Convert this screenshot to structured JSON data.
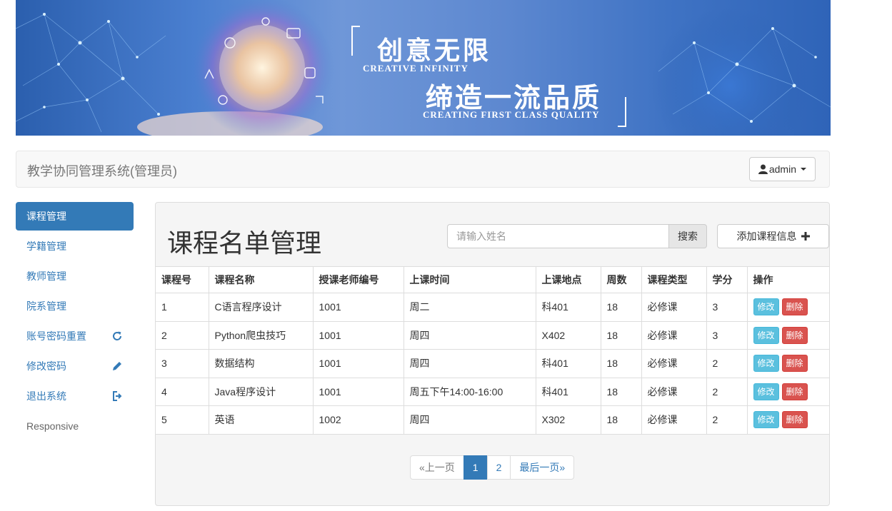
{
  "banner": {
    "title_cn": "创意无限",
    "subtitle_en": "CREATIVE INFINITY",
    "title2_cn": "缔造一流品质",
    "subtitle2_en": "CREATING FIRST CLASS QUALITY"
  },
  "navbar": {
    "brand": "教学协同管理系统(管理员)",
    "user": "admin"
  },
  "sidebar": {
    "items": [
      {
        "label": "课程管理",
        "icon": ""
      },
      {
        "label": "学籍管理",
        "icon": ""
      },
      {
        "label": "教师管理",
        "icon": ""
      },
      {
        "label": "院系管理",
        "icon": ""
      },
      {
        "label": "账号密码重置",
        "icon": "refresh-icon"
      },
      {
        "label": "修改密码",
        "icon": "pencil-icon"
      },
      {
        "label": "退出系统",
        "icon": "logout-icon"
      },
      {
        "label": "Responsive",
        "icon": ""
      }
    ]
  },
  "main": {
    "title": "课程名单管理",
    "search_placeholder": "请输入姓名",
    "search_button": "搜索",
    "add_button": "添加课程信息",
    "columns": [
      "课程号",
      "课程名称",
      "授课老师编号",
      "上课时间",
      "上课地点",
      "周数",
      "课程类型",
      "学分",
      "操作"
    ],
    "rows": [
      [
        "1",
        "C语言程序设计",
        "1001",
        "周二",
        "科401",
        "18",
        "必修课",
        "3"
      ],
      [
        "2",
        "Python爬虫技巧",
        "1001",
        "周四",
        "X402",
        "18",
        "必修课",
        "3"
      ],
      [
        "3",
        "数据结构",
        "1001",
        "周四",
        "科401",
        "18",
        "必修课",
        "2"
      ],
      [
        "4",
        "Java程序设计",
        "1001",
        "周五下午14:00-16:00",
        "科401",
        "18",
        "必修课",
        "2"
      ],
      [
        "5",
        "英语",
        "1002",
        "周四",
        "X302",
        "18",
        "必修课",
        "2"
      ]
    ],
    "edit_label": "修改",
    "delete_label": "删除",
    "pagination": {
      "prev": "«上一页",
      "pages": [
        "1",
        "2"
      ],
      "current": "1",
      "last": "最后一页»"
    }
  },
  "colors": {
    "primary": "#337ab7",
    "info": "#5bc0de",
    "danger": "#d9534f"
  }
}
